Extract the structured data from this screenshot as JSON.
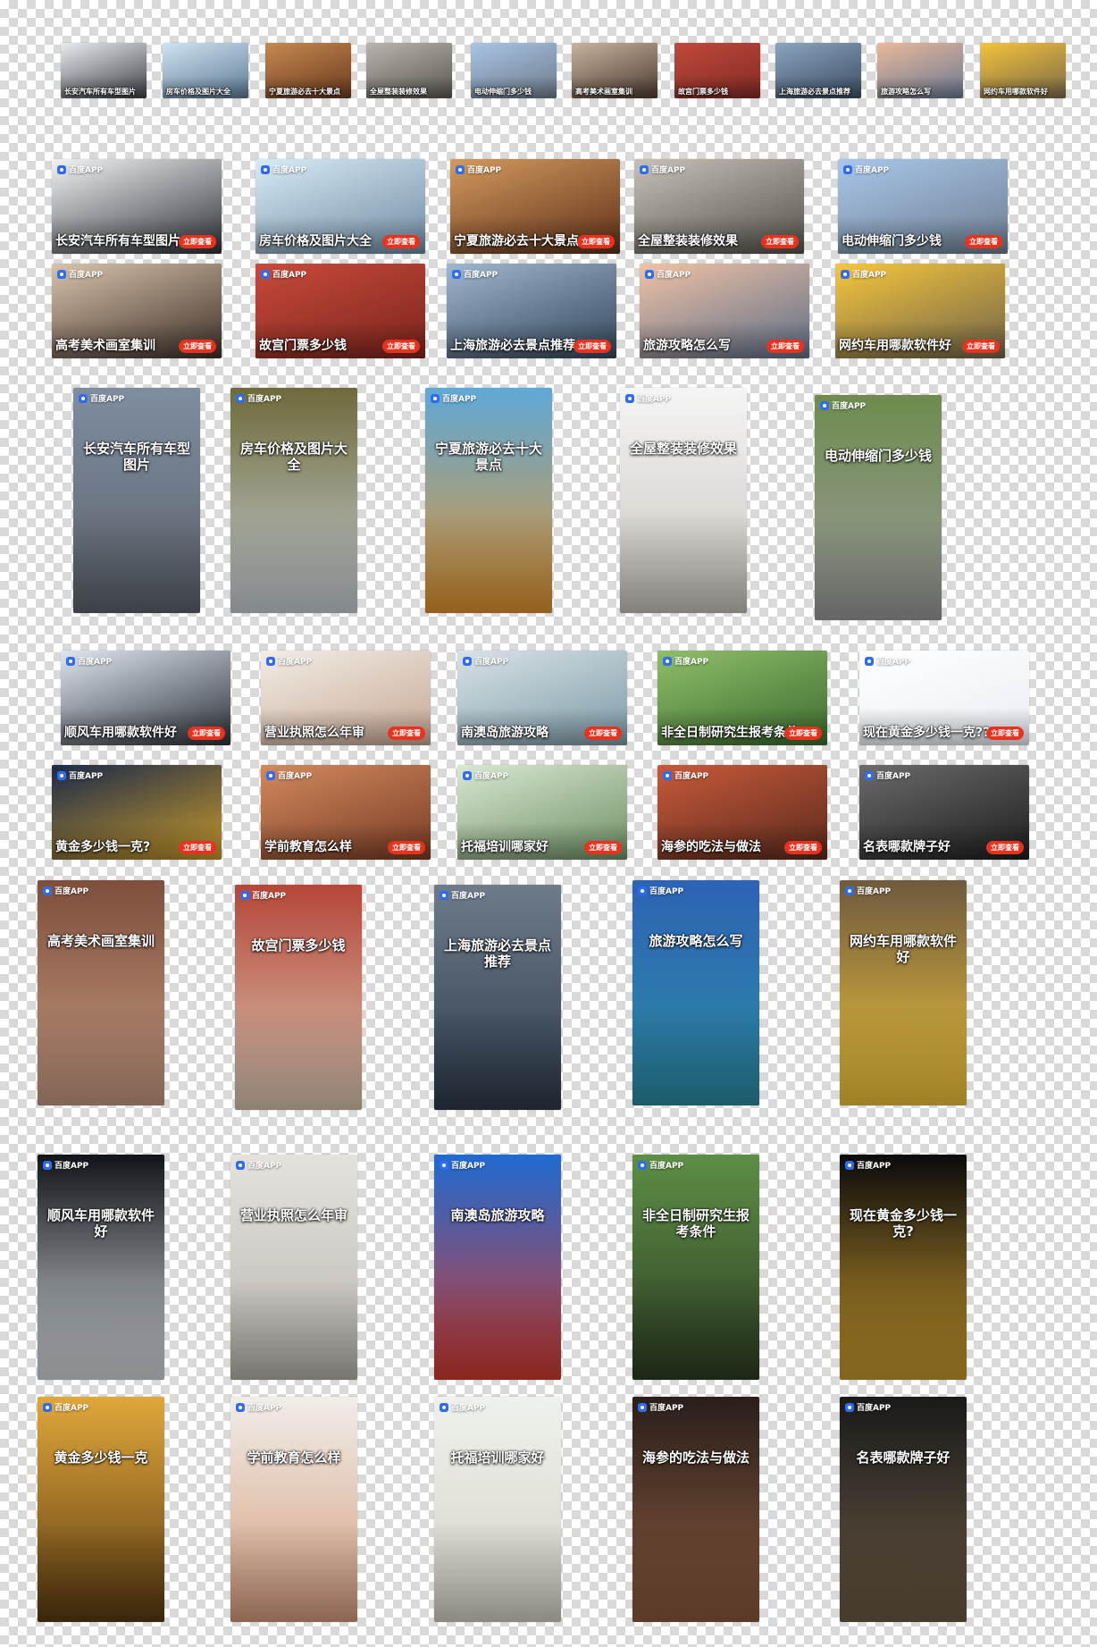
{
  "brand": "百度APP",
  "cta": "立即查看",
  "tiles": [
    {
      "size": "small",
      "caption": "长安汽车所有车型图片",
      "colors": [
        "#e9ecef",
        "#3b3f45"
      ]
    },
    {
      "size": "small",
      "caption": "房车价格及图片大全",
      "colors": [
        "#cfe3f2",
        "#5c7a93"
      ]
    },
    {
      "size": "small",
      "caption": "宁夏旅游必去十大景点",
      "colors": [
        "#c6884f",
        "#6a3b1e"
      ]
    },
    {
      "size": "small",
      "caption": "全屋整装装修效果",
      "colors": [
        "#b9b5ae",
        "#5a5650"
      ]
    },
    {
      "size": "small",
      "caption": "电动伸缩门多少钱",
      "colors": [
        "#a7c4e6",
        "#6e7b88"
      ]
    },
    {
      "size": "small",
      "caption": "高考美术画室集训",
      "colors": [
        "#c7b39d",
        "#4b3a31"
      ]
    },
    {
      "size": "small",
      "caption": "故宫门票多少钱",
      "colors": [
        "#c1493b",
        "#7f2a22"
      ]
    },
    {
      "size": "small",
      "caption": "上海旅游必去景点推荐",
      "colors": [
        "#8aa4bf",
        "#3b4d62"
      ]
    },
    {
      "size": "small",
      "caption": "旅游攻略怎么写",
      "colors": [
        "#e9b89a",
        "#6a7a93"
      ]
    },
    {
      "size": "small",
      "caption": "网约车用哪款软件好",
      "colors": [
        "#f4c23a",
        "#7a6a4a"
      ]
    },
    {
      "size": "h",
      "caption": "长安汽车所有车型图片",
      "colors": [
        "#f1f3f5",
        "#2d3136"
      ]
    },
    {
      "size": "h",
      "caption": "房车价格及图片大全",
      "colors": [
        "#d8ebf7",
        "#6e8aa0"
      ]
    },
    {
      "size": "h",
      "caption": "宁夏旅游必去十大景点",
      "colors": [
        "#d39a5e",
        "#5e2f18"
      ]
    },
    {
      "size": "h",
      "caption": "全屋整装装修效果",
      "colors": [
        "#c6c1b9",
        "#55514b"
      ]
    },
    {
      "size": "h",
      "caption": "电动伸缩门多少钱",
      "colors": [
        "#a9c7ea",
        "#6d7e90"
      ]
    },
    {
      "size": "h",
      "caption": "高考美术画室集训",
      "colors": [
        "#d8c3ab",
        "#3e3028"
      ]
    },
    {
      "size": "h",
      "caption": "故宫门票多少钱",
      "colors": [
        "#c84b3b",
        "#7b241c"
      ]
    },
    {
      "size": "h",
      "caption": "上海旅游必去景点推荐",
      "colors": [
        "#9fb7cf",
        "#33465b"
      ]
    },
    {
      "size": "h",
      "caption": "旅游攻略怎么写",
      "colors": [
        "#f0c2a4",
        "#5d6e88"
      ]
    },
    {
      "size": "h",
      "caption": "网约车用哪款软件好",
      "colors": [
        "#f6c63c",
        "#6f6449"
      ]
    },
    {
      "size": "v",
      "caption": "长安汽车所有车型图片",
      "colors": [
        "#7e8da0",
        "#5d636b"
      ]
    },
    {
      "size": "v",
      "caption": "房车价格及图片大全",
      "colors": [
        "#6e6a3a",
        "#c9d0d6"
      ]
    },
    {
      "size": "v",
      "caption": "宁夏旅游必去十大景点",
      "colors": [
        "#5ea9d8",
        "#e1932f"
      ]
    },
    {
      "size": "v",
      "caption": "全屋整装装修效果",
      "colors": [
        "#f5f5f5",
        "#c9c4bd"
      ]
    },
    {
      "size": "v",
      "caption": "电动伸缩门多少钱",
      "colors": [
        "#6e8c4e",
        "#9b9b9b"
      ]
    },
    {
      "size": "h",
      "caption": "顺风车用哪款软件好",
      "colors": [
        "#dfe6ee",
        "#2b3037"
      ]
    },
    {
      "size": "h",
      "caption": "营业执照怎么年审",
      "colors": [
        "#f1ede6",
        "#c7a793"
      ]
    },
    {
      "size": "h",
      "caption": "南澳岛旅游攻略",
      "colors": [
        "#d9e2e6",
        "#7b9aa7"
      ]
    },
    {
      "size": "h",
      "caption": "非全日制研究生报考条件",
      "colors": [
        "#8fbf6a",
        "#3b6b2d"
      ]
    },
    {
      "size": "h",
      "caption": "现在黄金多少钱一克??",
      "colors": [
        "#ffffff",
        "#e9edf3"
      ]
    },
    {
      "size": "h",
      "caption": "黄金多少钱一克?",
      "colors": [
        "#1b2a4a",
        "#c89a2a"
      ]
    },
    {
      "size": "h",
      "caption": "学前教育怎么样",
      "colors": [
        "#d18a5e",
        "#7a3b24"
      ]
    },
    {
      "size": "h",
      "caption": "托福培训哪家好",
      "colors": [
        "#d9e8d2",
        "#6e8f63"
      ]
    },
    {
      "size": "h",
      "caption": "海参的吃法与做法",
      "colors": [
        "#c85a3a",
        "#5a2a1c"
      ]
    },
    {
      "size": "h",
      "caption": "名表哪款牌子好",
      "colors": [
        "#6b6b6b",
        "#1e1e1e"
      ]
    },
    {
      "size": "v",
      "caption": "高考美术画室集训",
      "colors": [
        "#7d4f3c",
        "#c79b82"
      ]
    },
    {
      "size": "v",
      "caption": "故宫门票多少钱",
      "colors": [
        "#b64638",
        "#d8c7b2"
      ]
    },
    {
      "size": "v",
      "caption": "上海旅游必去景点推荐",
      "colors": [
        "#6d7b8a",
        "#2c3a4a"
      ]
    },
    {
      "size": "v",
      "caption": "旅游攻略怎么写",
      "colors": [
        "#2d63b5",
        "#2c8ca3"
      ]
    },
    {
      "size": "v",
      "caption": "网约车用哪款软件好",
      "colors": [
        "#6e5a3e",
        "#f2c53a"
      ]
    },
    {
      "size": "v",
      "caption": "顺风车用哪款软件好",
      "colors": [
        "#111418",
        "#d5dade"
      ]
    },
    {
      "size": "v",
      "caption": "营业执照怎么年审",
      "colors": [
        "#e5e2dd",
        "#b9b4ae"
      ]
    },
    {
      "size": "v",
      "caption": "南澳岛旅游攻略",
      "colors": [
        "#1f6ad1",
        "#d23b2f"
      ]
    },
    {
      "size": "v",
      "caption": "非全日制研究生报考条件",
      "colors": [
        "#5d8f45",
        "#2c3c22"
      ]
    },
    {
      "size": "v",
      "caption": "现在黄金多少钱一克?",
      "colors": [
        "#0b0b0b",
        "#c99a2d"
      ]
    },
    {
      "size": "v",
      "caption": "黄金多少钱一克",
      "colors": [
        "#e0a73a",
        "#5a3a12"
      ]
    },
    {
      "size": "v",
      "caption": "学前教育怎么样",
      "colors": [
        "#f0ede8",
        "#d59e7d"
      ]
    },
    {
      "size": "v",
      "caption": "托福培训哪家好",
      "colors": [
        "#eef1ec",
        "#d6d2c6"
      ]
    },
    {
      "size": "v",
      "caption": "海参的吃法与做法",
      "colors": [
        "#2a1f1b",
        "#8a5a3c"
      ]
    },
    {
      "size": "v",
      "caption": "名表哪款牌子好",
      "colors": [
        "#1a1a1a",
        "#6b5a44"
      ]
    }
  ]
}
